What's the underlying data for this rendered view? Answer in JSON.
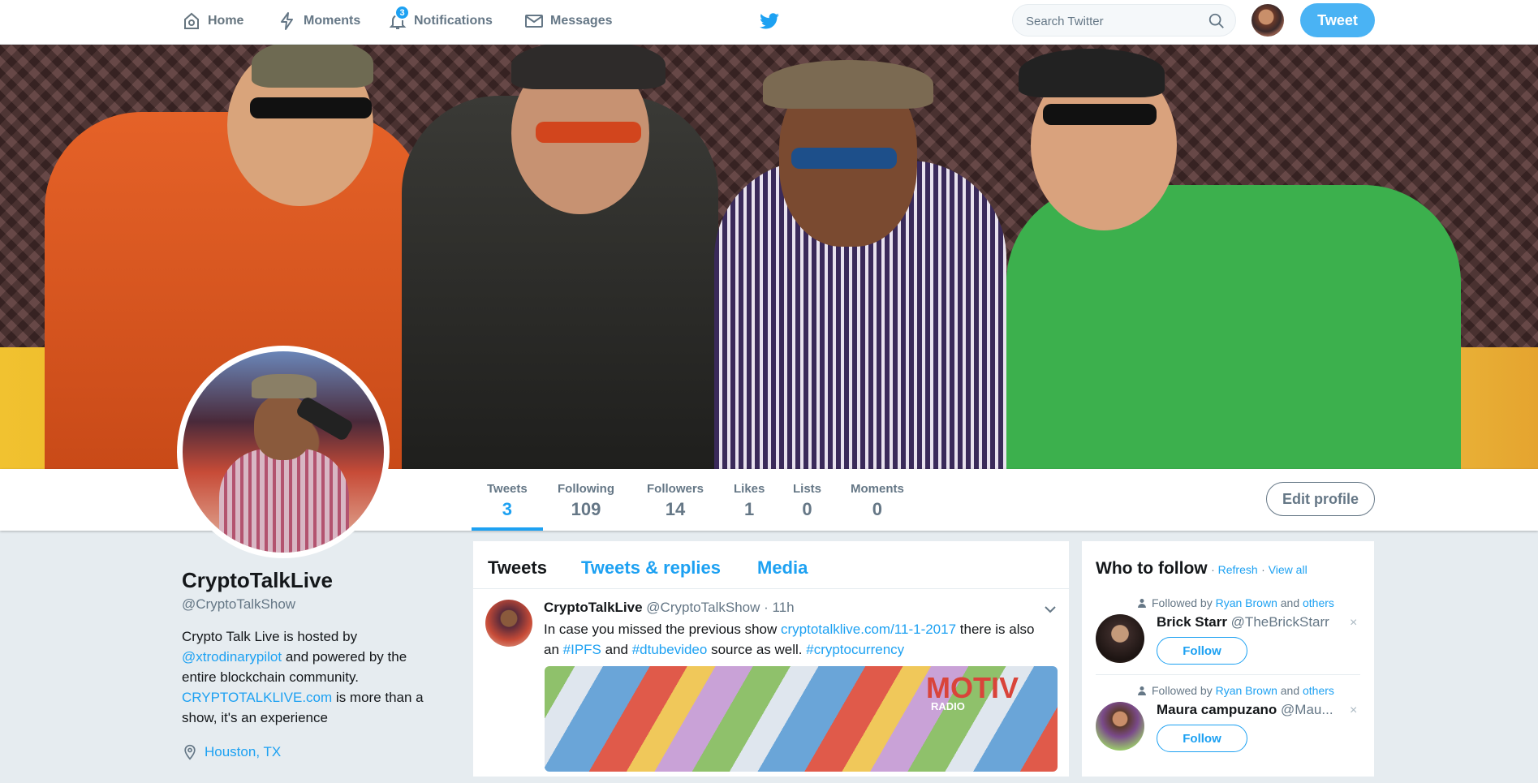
{
  "nav": {
    "home": "Home",
    "moments": "Moments",
    "notifications": "Notifications",
    "notifications_badge": "3",
    "messages": "Messages",
    "search_placeholder": "Search Twitter",
    "tweet_button": "Tweet",
    "brand_color": "#1da1f2"
  },
  "profile_nav": {
    "stats": [
      {
        "label": "Tweets",
        "value": "3"
      },
      {
        "label": "Following",
        "value": "109"
      },
      {
        "label": "Followers",
        "value": "14"
      },
      {
        "label": "Likes",
        "value": "1"
      },
      {
        "label": "Lists",
        "value": "0"
      },
      {
        "label": "Moments",
        "value": "0"
      }
    ],
    "edit_profile": "Edit profile"
  },
  "profile": {
    "name": "CryptoTalkLive",
    "handle": "@CryptoTalkShow",
    "bio_1": "Crypto Talk Live is hosted by ",
    "bio_mention": "@xtrodinarypilot",
    "bio_2": " and powered by the entire blockchain community. ",
    "bio_link": "CRYPTOTALKLIVE.com",
    "bio_3": " is more than a show, it's an experience",
    "location": "Houston, TX"
  },
  "timeline": {
    "tabs": [
      "Tweets",
      "Tweets & replies",
      "Media"
    ],
    "tweet": {
      "name": "CryptoTalkLive",
      "handle": "@CryptoTalkShow",
      "time": "· 11h",
      "text_1": "In case you missed the previous show ",
      "link": "cryptotalklive.com/11-1-2017",
      "text_2": "  there is also an ",
      "tag_1": "#IPFS",
      "text_3": " and ",
      "tag_2": "#dtubevideo",
      "text_4": " source as well. ",
      "tag_3": "#cryptocurrency",
      "media_logo": "MOTIV",
      "media_sub": "RADIO"
    }
  },
  "who_to_follow": {
    "title": "Who to follow",
    "refresh": "Refresh",
    "view_all": "View all",
    "sep": " · ",
    "items": [
      {
        "context_prefix": "Followed by ",
        "context_user": "Ryan Brown",
        "context_and": " and ",
        "context_others": "others",
        "name": "Brick Starr",
        "handle": "@TheBrickStarr",
        "follow": "Follow",
        "dismiss": "×"
      },
      {
        "context_prefix": "Followed by ",
        "context_user": "Ryan Brown",
        "context_and": " and ",
        "context_others": "others",
        "name": "Maura campuzano",
        "handle": "@Mau...",
        "follow": "Follow",
        "dismiss": "×"
      }
    ]
  }
}
